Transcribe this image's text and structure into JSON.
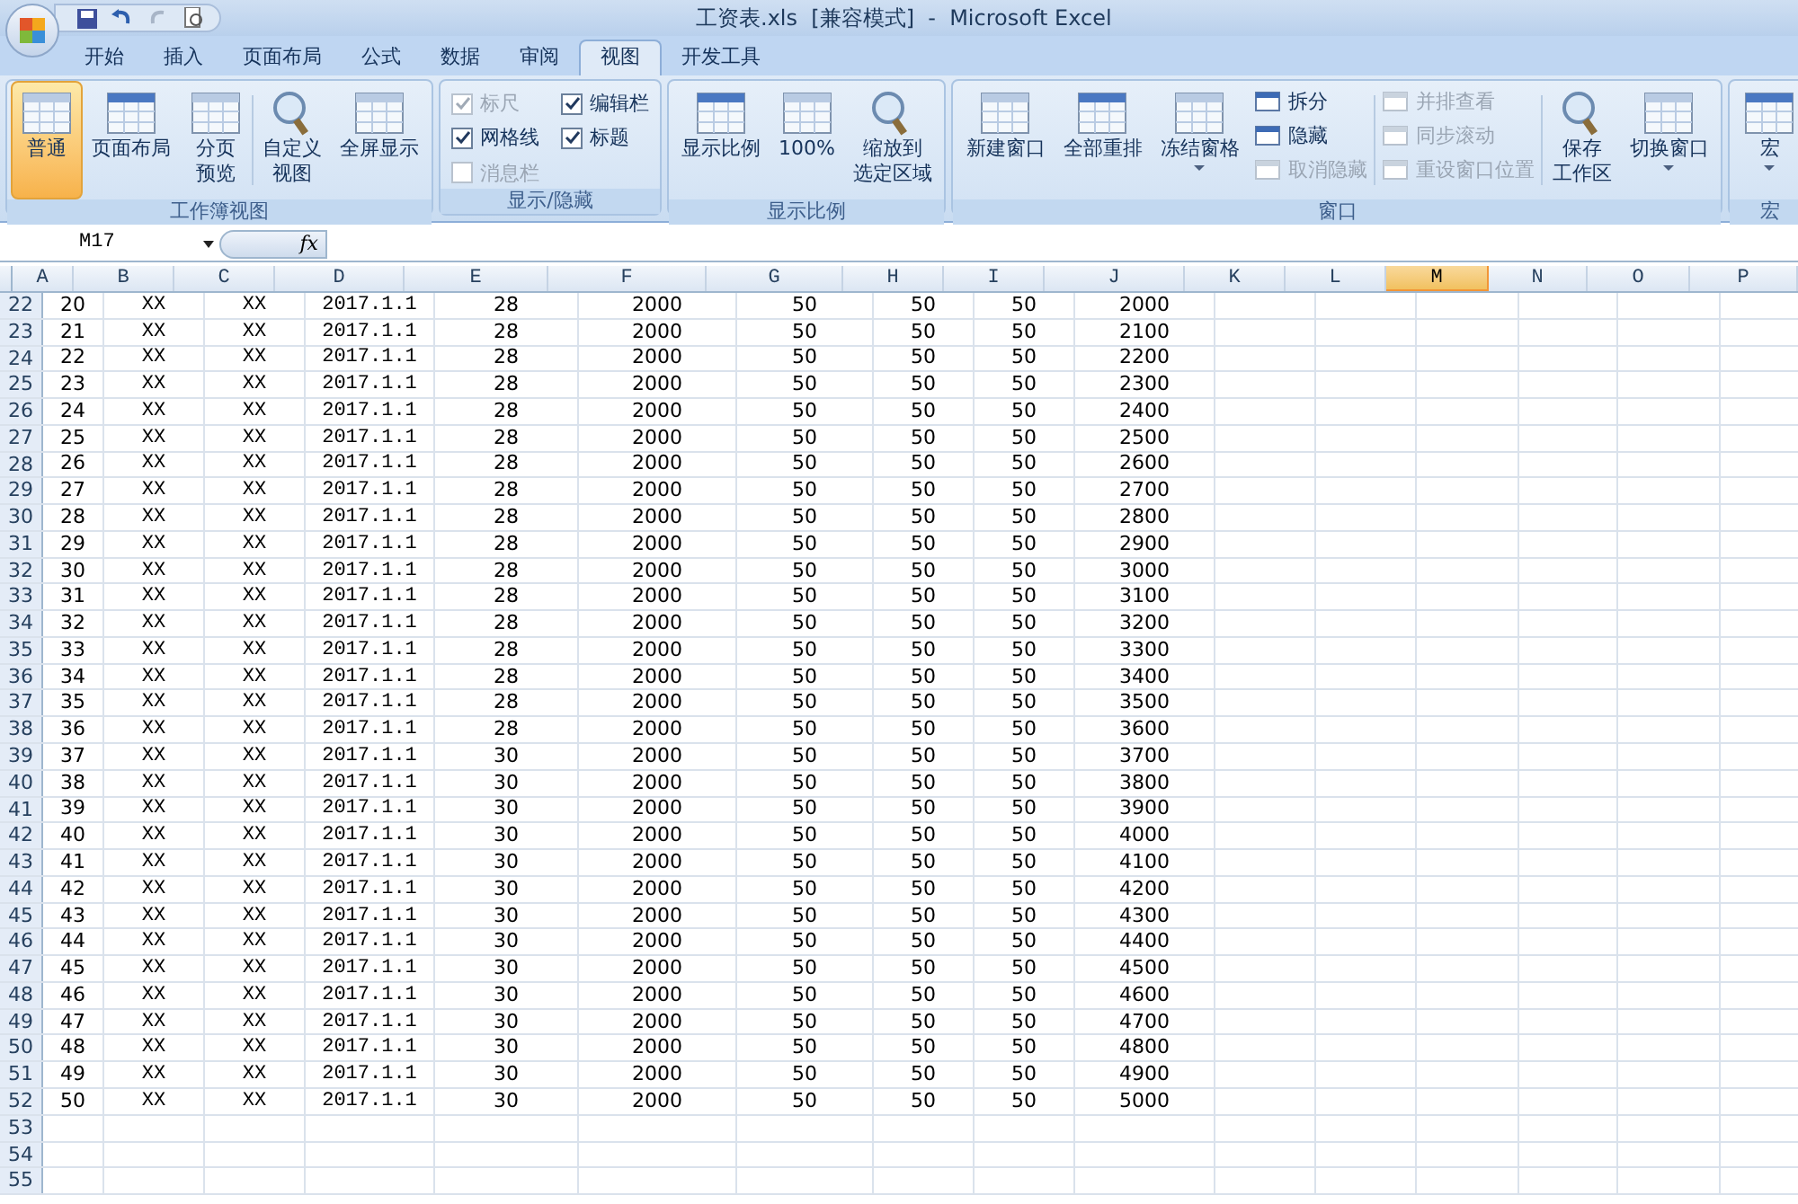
{
  "window": {
    "title": "工资表.xls  [兼容模式]  -  Microsoft Excel"
  },
  "ribbon_tabs": [
    {
      "label": "开始",
      "selected": false
    },
    {
      "label": "插入",
      "selected": false
    },
    {
      "label": "页面布局",
      "selected": false
    },
    {
      "label": "公式",
      "selected": false
    },
    {
      "label": "数据",
      "selected": false
    },
    {
      "label": "审阅",
      "selected": false
    },
    {
      "label": "视图",
      "selected": true
    },
    {
      "label": "开发工具",
      "selected": false
    }
  ],
  "ribbon_groups": [
    {
      "label": "工作簿视图",
      "items": [
        {
          "kind": "large",
          "lines": [
            "普通"
          ],
          "selected": true
        },
        {
          "kind": "large",
          "lines": [
            "页面布局"
          ],
          "selected": false
        },
        {
          "kind": "large",
          "lines": [
            "分页",
            "预览"
          ],
          "selected": false
        },
        {
          "kind": "separator"
        },
        {
          "kind": "large",
          "lines": [
            "自定义",
            "视图"
          ],
          "selected": false
        },
        {
          "kind": "large",
          "lines": [
            "全屏显示"
          ],
          "selected": false
        }
      ]
    },
    {
      "label": "显示/隐藏",
      "items": [
        {
          "kind": "checks",
          "children": [
            {
              "label": "标尺",
              "checked": true,
              "disabled": true
            },
            {
              "label": "网格线",
              "checked": true,
              "disabled": false
            },
            {
              "label": "消息栏",
              "checked": false,
              "disabled": true
            },
            {
              "label": "编辑栏",
              "checked": true,
              "disabled": false
            },
            {
              "label": "标题",
              "checked": true,
              "disabled": false
            }
          ]
        }
      ]
    },
    {
      "label": "显示比例",
      "items": [
        {
          "kind": "large",
          "lines": [
            "显示比例"
          ],
          "selected": false
        },
        {
          "kind": "large",
          "lines": [
            "100%"
          ],
          "selected": false
        },
        {
          "kind": "large",
          "lines": [
            "缩放到",
            "选定区域"
          ],
          "selected": false
        }
      ]
    },
    {
      "label": "窗口",
      "items": [
        {
          "kind": "large",
          "lines": [
            "新建窗口"
          ],
          "selected": false
        },
        {
          "kind": "large",
          "lines": [
            "全部重排"
          ],
          "selected": false
        },
        {
          "kind": "large",
          "lines": [
            "冻结窗格"
          ],
          "selected": false,
          "dropdown": true
        },
        {
          "kind": "stack",
          "children": [
            {
              "label": "拆分",
              "disabled": false
            },
            {
              "label": "隐藏",
              "disabled": false
            },
            {
              "label": "取消隐藏",
              "disabled": true
            }
          ]
        },
        {
          "kind": "separator"
        },
        {
          "kind": "stack",
          "children": [
            {
              "label": "并排查看",
              "disabled": true
            },
            {
              "label": "同步滚动",
              "disabled": true
            },
            {
              "label": "重设窗口位置",
              "disabled": true
            }
          ]
        },
        {
          "kind": "separator"
        },
        {
          "kind": "large",
          "lines": [
            "保存",
            "工作区"
          ],
          "selected": false
        },
        {
          "kind": "large",
          "lines": [
            "切换窗口"
          ],
          "selected": false,
          "dropdown": true
        }
      ]
    },
    {
      "label": "宏",
      "items": [
        {
          "kind": "large",
          "lines": [
            "宏"
          ],
          "selected": false,
          "dropdown": true
        }
      ]
    }
  ],
  "formula_bar": {
    "name_box": "M17",
    "function_button": "fx"
  },
  "sheet": {
    "columns": [
      {
        "label": "A",
        "selected": false
      },
      {
        "label": "B",
        "selected": false
      },
      {
        "label": "C",
        "selected": false
      },
      {
        "label": "D",
        "selected": false
      },
      {
        "label": "E",
        "selected": false
      },
      {
        "label": "F",
        "selected": false
      },
      {
        "label": "G",
        "selected": false
      },
      {
        "label": "H",
        "selected": false
      },
      {
        "label": "I",
        "selected": false
      },
      {
        "label": "J",
        "selected": false
      },
      {
        "label": "K",
        "selected": false
      },
      {
        "label": "L",
        "selected": false
      },
      {
        "label": "M",
        "selected": true
      },
      {
        "label": "N",
        "selected": false
      },
      {
        "label": "O",
        "selected": false
      },
      {
        "label": "P",
        "selected": false
      }
    ],
    "rows": [
      {
        "header": "22",
        "cells": [
          "20",
          "XX",
          "XX",
          "2017.1.1",
          "28",
          "2000",
          "50",
          "50",
          "50",
          "2000"
        ]
      },
      {
        "header": "23",
        "cells": [
          "21",
          "XX",
          "XX",
          "2017.1.1",
          "28",
          "2000",
          "50",
          "50",
          "50",
          "2100"
        ]
      },
      {
        "header": "24",
        "cells": [
          "22",
          "XX",
          "XX",
          "2017.1.1",
          "28",
          "2000",
          "50",
          "50",
          "50",
          "2200"
        ]
      },
      {
        "header": "25",
        "cells": [
          "23",
          "XX",
          "XX",
          "2017.1.1",
          "28",
          "2000",
          "50",
          "50",
          "50",
          "2300"
        ]
      },
      {
        "header": "26",
        "cells": [
          "24",
          "XX",
          "XX",
          "2017.1.1",
          "28",
          "2000",
          "50",
          "50",
          "50",
          "2400"
        ]
      },
      {
        "header": "27",
        "cells": [
          "25",
          "XX",
          "XX",
          "2017.1.1",
          "28",
          "2000",
          "50",
          "50",
          "50",
          "2500"
        ]
      },
      {
        "header": "28",
        "cells": [
          "26",
          "XX",
          "XX",
          "2017.1.1",
          "28",
          "2000",
          "50",
          "50",
          "50",
          "2600"
        ]
      },
      {
        "header": "29",
        "cells": [
          "27",
          "XX",
          "XX",
          "2017.1.1",
          "28",
          "2000",
          "50",
          "50",
          "50",
          "2700"
        ]
      },
      {
        "header": "30",
        "cells": [
          "28",
          "XX",
          "XX",
          "2017.1.1",
          "28",
          "2000",
          "50",
          "50",
          "50",
          "2800"
        ]
      },
      {
        "header": "31",
        "cells": [
          "29",
          "XX",
          "XX",
          "2017.1.1",
          "28",
          "2000",
          "50",
          "50",
          "50",
          "2900"
        ]
      },
      {
        "header": "32",
        "cells": [
          "30",
          "XX",
          "XX",
          "2017.1.1",
          "28",
          "2000",
          "50",
          "50",
          "50",
          "3000"
        ]
      },
      {
        "header": "33",
        "cells": [
          "31",
          "XX",
          "XX",
          "2017.1.1",
          "28",
          "2000",
          "50",
          "50",
          "50",
          "3100"
        ]
      },
      {
        "header": "34",
        "cells": [
          "32",
          "XX",
          "XX",
          "2017.1.1",
          "28",
          "2000",
          "50",
          "50",
          "50",
          "3200"
        ]
      },
      {
        "header": "35",
        "cells": [
          "33",
          "XX",
          "XX",
          "2017.1.1",
          "28",
          "2000",
          "50",
          "50",
          "50",
          "3300"
        ]
      },
      {
        "header": "36",
        "cells": [
          "34",
          "XX",
          "XX",
          "2017.1.1",
          "28",
          "2000",
          "50",
          "50",
          "50",
          "3400"
        ]
      },
      {
        "header": "37",
        "cells": [
          "35",
          "XX",
          "XX",
          "2017.1.1",
          "28",
          "2000",
          "50",
          "50",
          "50",
          "3500"
        ]
      },
      {
        "header": "38",
        "cells": [
          "36",
          "XX",
          "XX",
          "2017.1.1",
          "28",
          "2000",
          "50",
          "50",
          "50",
          "3600"
        ]
      },
      {
        "header": "39",
        "cells": [
          "37",
          "XX",
          "XX",
          "2017.1.1",
          "30",
          "2000",
          "50",
          "50",
          "50",
          "3700"
        ]
      },
      {
        "header": "40",
        "cells": [
          "38",
          "XX",
          "XX",
          "2017.1.1",
          "30",
          "2000",
          "50",
          "50",
          "50",
          "3800"
        ]
      },
      {
        "header": "41",
        "cells": [
          "39",
          "XX",
          "XX",
          "2017.1.1",
          "30",
          "2000",
          "50",
          "50",
          "50",
          "3900"
        ]
      },
      {
        "header": "42",
        "cells": [
          "40",
          "XX",
          "XX",
          "2017.1.1",
          "30",
          "2000",
          "50",
          "50",
          "50",
          "4000"
        ]
      },
      {
        "header": "43",
        "cells": [
          "41",
          "XX",
          "XX",
          "2017.1.1",
          "30",
          "2000",
          "50",
          "50",
          "50",
          "4100"
        ]
      },
      {
        "header": "44",
        "cells": [
          "42",
          "XX",
          "XX",
          "2017.1.1",
          "30",
          "2000",
          "50",
          "50",
          "50",
          "4200"
        ]
      },
      {
        "header": "45",
        "cells": [
          "43",
          "XX",
          "XX",
          "2017.1.1",
          "30",
          "2000",
          "50",
          "50",
          "50",
          "4300"
        ]
      },
      {
        "header": "46",
        "cells": [
          "44",
          "XX",
          "XX",
          "2017.1.1",
          "30",
          "2000",
          "50",
          "50",
          "50",
          "4400"
        ]
      },
      {
        "header": "47",
        "cells": [
          "45",
          "XX",
          "XX",
          "2017.1.1",
          "30",
          "2000",
          "50",
          "50",
          "50",
          "4500"
        ]
      },
      {
        "header": "48",
        "cells": [
          "46",
          "XX",
          "XX",
          "2017.1.1",
          "30",
          "2000",
          "50",
          "50",
          "50",
          "4600"
        ]
      },
      {
        "header": "49",
        "cells": [
          "47",
          "XX",
          "XX",
          "2017.1.1",
          "30",
          "2000",
          "50",
          "50",
          "50",
          "4700"
        ]
      },
      {
        "header": "50",
        "cells": [
          "48",
          "XX",
          "XX",
          "2017.1.1",
          "30",
          "2000",
          "50",
          "50",
          "50",
          "4800"
        ]
      },
      {
        "header": "51",
        "cells": [
          "49",
          "XX",
          "XX",
          "2017.1.1",
          "30",
          "2000",
          "50",
          "50",
          "50",
          "4900"
        ]
      },
      {
        "header": "52",
        "cells": [
          "50",
          "XX",
          "XX",
          "2017.1.1",
          "30",
          "2000",
          "50",
          "50",
          "50",
          "5000"
        ]
      },
      {
        "header": "53"
      },
      {
        "header": "54"
      },
      {
        "header": "55"
      }
    ]
  }
}
